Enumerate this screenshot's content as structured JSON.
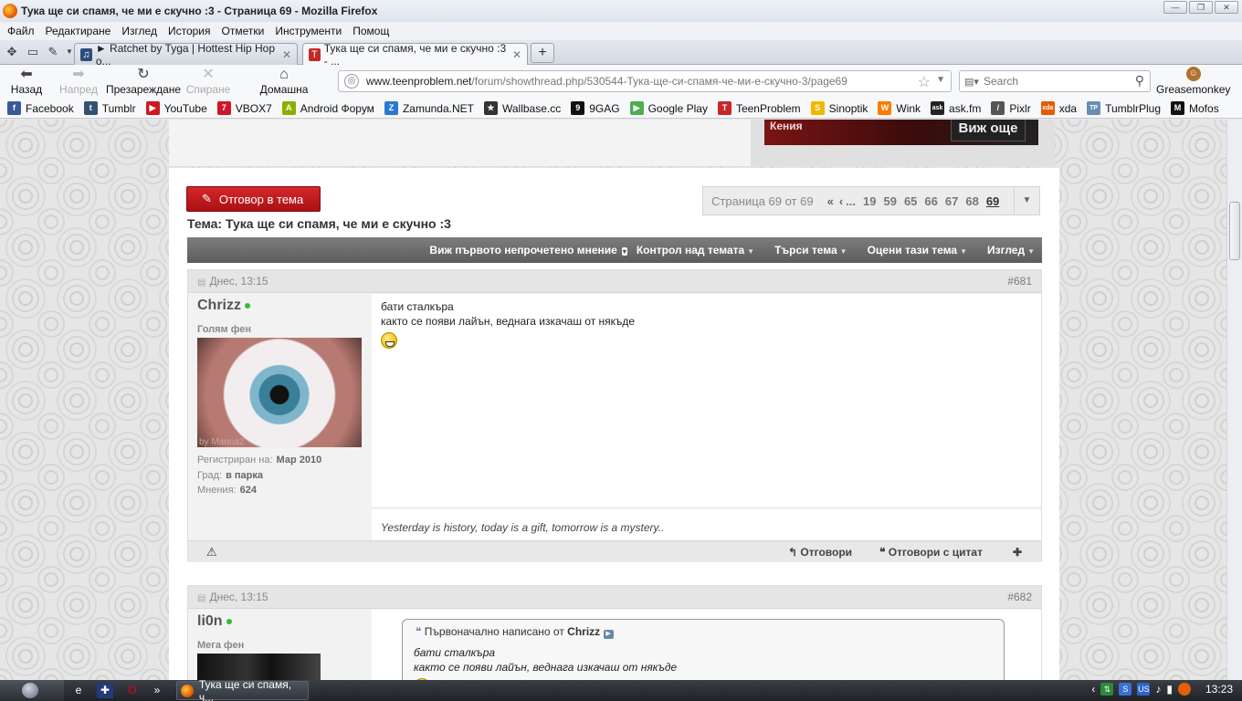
{
  "window": {
    "title": "Тука ще си спамя, че ми е скучно :3 - Страница 69 - Mozilla Firefox",
    "controls": [
      "—",
      "❐",
      "✕"
    ]
  },
  "menu": [
    "Файл",
    "Редактиране",
    "Изглед",
    "История",
    "Отметки",
    "Инструменти",
    "Помощ"
  ],
  "tabs": [
    {
      "title": "► Ratchet by Tyga | Hottest Hip Hop o...",
      "close": "✕",
      "active": false
    },
    {
      "title": "Тука ще си спамя, че ми е скучно :3 - ...",
      "close": "✕",
      "active": true
    }
  ],
  "newtab_label": "+",
  "nav": {
    "back": "Назад",
    "forward": "Напред",
    "reload": "Презареждане",
    "stop": "Спиране",
    "home": "Домашна страница",
    "url_host": "www.teenproblem.net",
    "url_path": "/forum/showthread.php/530544-Тука-ще-си-спамя-че-ми-е-скучно-3/page69",
    "search_placeholder": "Search",
    "greasemonkey": "Greasemonkey"
  },
  "bookmarks": [
    {
      "label": "Facebook",
      "color": "#3b5998",
      "glyph": "f"
    },
    {
      "label": "Tumblr",
      "color": "#34526f",
      "glyph": "t"
    },
    {
      "label": "YouTube",
      "color": "#cc181e",
      "glyph": "▶"
    },
    {
      "label": "VBOX7",
      "color": "#d0142c",
      "glyph": "7"
    },
    {
      "label": "Android Форум",
      "color": "#8ab000",
      "glyph": "A"
    },
    {
      "label": "Zamunda.NET",
      "color": "#2a7ad0",
      "glyph": "Z"
    },
    {
      "label": "Wallbase.cc",
      "color": "#333333",
      "glyph": "★"
    },
    {
      "label": "9GAG",
      "color": "#111111",
      "glyph": "9"
    },
    {
      "label": "Google Play",
      "color": "#4caf50",
      "glyph": "▶"
    },
    {
      "label": "TeenProblem",
      "color": "#c62828",
      "glyph": "T"
    },
    {
      "label": "Sinoptik",
      "color": "#f2b800",
      "glyph": "S"
    },
    {
      "label": "Wink",
      "color": "#ff7a00",
      "glyph": "W"
    },
    {
      "label": "ask.fm",
      "color": "#222222",
      "glyph": "ask"
    },
    {
      "label": "Pixlr",
      "color": "#555555",
      "glyph": "/"
    },
    {
      "label": "xda",
      "color": "#e65c00",
      "glyph": "xda"
    },
    {
      "label": "TumblrPlug",
      "color": "#6a8db5",
      "glyph": "TP"
    },
    {
      "label": "Mofos",
      "color": "#111111",
      "glyph": "M"
    }
  ],
  "ad": {
    "left_text": "Кения",
    "button": "Виж още"
  },
  "thread": {
    "reply_button": "Отговор в тема",
    "title": "Тема: Тука ще си спамя, че ми е скучно :3",
    "pagination": {
      "label": "Страница 69 от 69",
      "first": "«",
      "prev": "‹",
      "dots": "...",
      "pages": [
        "19",
        "59",
        "65",
        "66",
        "67",
        "68",
        "69"
      ],
      "current": "69",
      "dropdown": "▼"
    },
    "toolbar": [
      "Виж първото непрочетено мнение",
      "Контрол над темата",
      "Търси тема",
      "Оцени тази тема",
      "Изглед"
    ]
  },
  "posts": [
    {
      "date": "Днес, 13:15",
      "number": "#681",
      "username": "Chrizz",
      "user_title": "Голям фен",
      "avatar_watermark": "by Manna2",
      "registered_label": "Регистриран на:",
      "registered": "Мар 2010",
      "city_label": "Град:",
      "city": "в парка",
      "posts_label": "Мнения:",
      "posts": "624",
      "line1": "бати сталкъра",
      "line2": "както се появи лайън, веднага изкачаш от някъде",
      "signature": "Yesterday is history, today is a gift, tomorrow is a mystery..",
      "reply": "Отговори",
      "reply_quote": "Отговори с цитат"
    },
    {
      "date": "Днес, 13:15",
      "number": "#682",
      "username": "li0n",
      "user_title": "Мега фен",
      "quote_header": "Първоначално написано от",
      "quote_author": "Chrizz",
      "quote_line1": "бати сталкъра",
      "quote_line2": "както се появи лайън, веднага изкачаш от някъде"
    }
  ],
  "taskbar": {
    "window": "Тука ще си спамя, ч...",
    "lang": "US",
    "time": "13:23"
  }
}
